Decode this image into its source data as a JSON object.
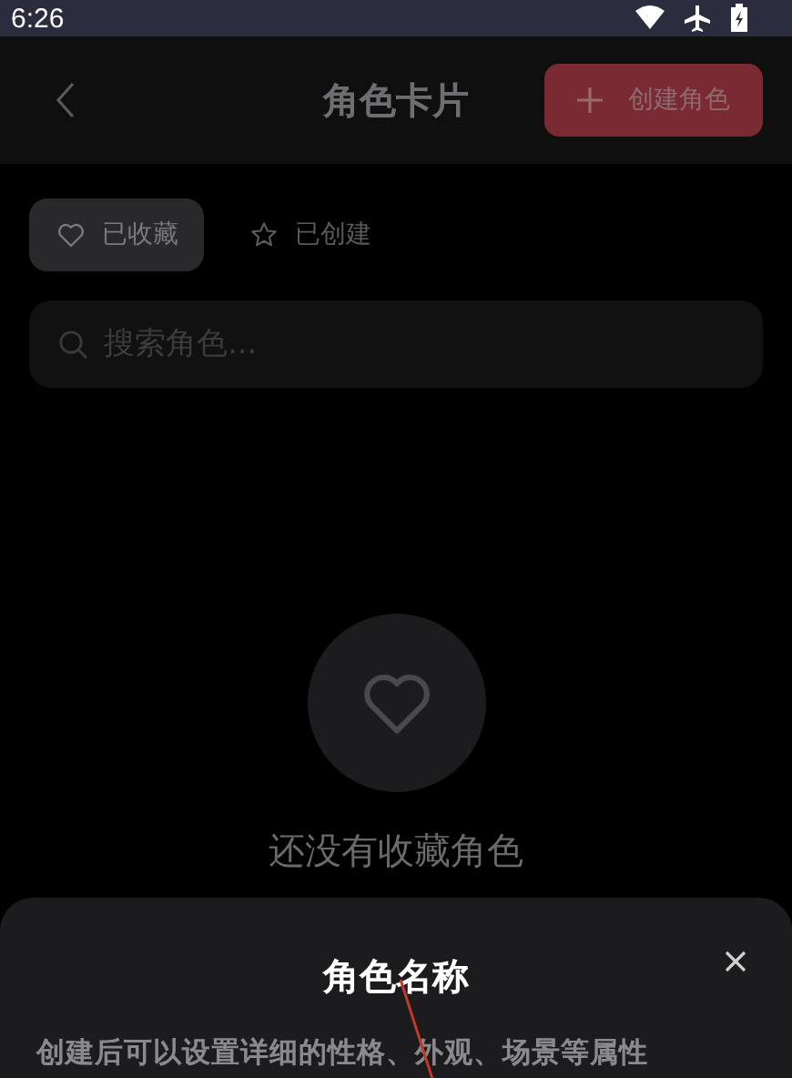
{
  "status_bar": {
    "time": "6:26"
  },
  "header": {
    "title": "角色卡片",
    "action": "创建角色"
  },
  "tabs": [
    {
      "label": "已收藏",
      "kind": "heart",
      "selected": true
    },
    {
      "label": "已创建",
      "kind": "star",
      "selected": false
    }
  ],
  "search": {
    "placeholder": "搜索角色..."
  },
  "empty_state": {
    "message": "还没有收藏角色"
  },
  "sheet": {
    "title": "角色名称",
    "description": "创建后可以设置详细的性格、外观、场景等属性"
  }
}
